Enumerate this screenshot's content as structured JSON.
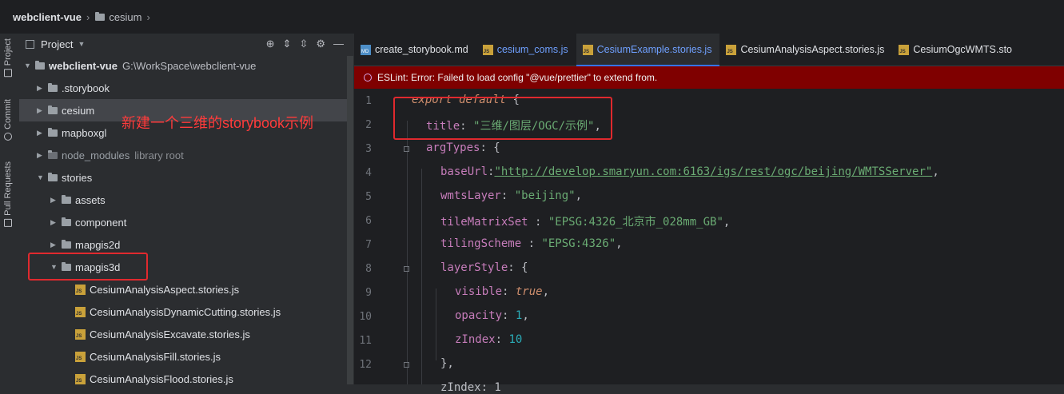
{
  "breadcrumb": {
    "project": "webclient-vue",
    "folder": "cesium"
  },
  "left_bar": {
    "project": "Project",
    "commit": "Commit",
    "pull_requests": "Pull Requests"
  },
  "project_panel": {
    "title": "Project",
    "tree": {
      "root_name": "webclient-vue",
      "root_path": "G:\\WorkSpace\\webclient-vue",
      "storybook": ".storybook",
      "cesium": "cesium",
      "mapboxgl": "mapboxgl",
      "node_modules": "node_modules",
      "node_modules_hint": "library root",
      "stories": "stories",
      "assets": "assets",
      "component": "component",
      "mapgis2d": "mapgis2d",
      "mapgis3d": "mapgis3d",
      "files": [
        "CesiumAnalysisAspect.stories.js",
        "CesiumAnalysisDynamicCutting.stories.js",
        "CesiumAnalysisExcavate.stories.js",
        "CesiumAnalysisFill.stories.js",
        "CesiumAnalysisFlood.stories.js"
      ],
      "js_badge": "JS"
    },
    "annotation": "新建一个三维的storybook示例"
  },
  "editor": {
    "tabs": [
      "create_storybook.md",
      "cesium_coms.js",
      "CesiumExample.stories.js",
      "CesiumAnalysisAspect.stories.js",
      "CesiumOgcWMTS.sto"
    ],
    "md_badge": "MD",
    "eslint": "ESLint: Error: Failed to load config \"@vue/prettier\" to extend from.",
    "line_numbers": [
      "1",
      "2",
      "3",
      "4",
      "5",
      "6",
      "7",
      "8",
      "9",
      "10",
      "11",
      "12"
    ],
    "code": {
      "l1_kw": "export default",
      "l1_p": " {",
      "l2_key": "title",
      "l2_val": "\"三维/图层/OGC/示例\"",
      "l3_key": "argTypes",
      "l3_p": ": {",
      "l4_key": "baseUrl",
      "l4_val": "\"http://develop.smaryun.com:6163/igs/rest/ogc/beijing/WMTSServer\"",
      "l5_key": "wmtsLayer",
      "l5_val": "\"beijing\"",
      "l6_key": "tileMatrixSet",
      "l6_val": "\"EPSG:4326_北京市_028mm_GB\"",
      "l7_key": "tilingScheme",
      "l7_val": "\"EPSG:4326\"",
      "l8_key": "layerStyle",
      "l8_p": ": {",
      "l9_key": "visible",
      "l9_val": "true",
      "l10_key": "opacity",
      "l10_val": "1",
      "l11_key": "zIndex",
      "l11_val": "10",
      "l12": "},",
      "l13": "zIndex: 1"
    }
  }
}
